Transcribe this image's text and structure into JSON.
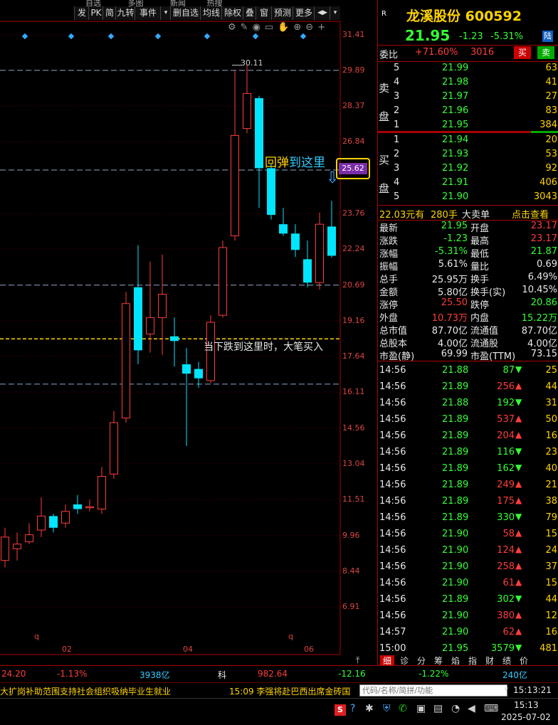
{
  "toolbar": {
    "buttons": [
      "发",
      "PK",
      "简",
      "九转",
      "事件",
      "▾",
      "删自选",
      "均线",
      "除权",
      "叠",
      "窗",
      "预测",
      "更多",
      "◀▶",
      "▾"
    ],
    "top_menu": [
      "自选",
      "多图",
      "新闻",
      "热搜"
    ]
  },
  "chart": {
    "price_labels": [
      "31.41",
      "29.89",
      "28.37",
      "26.84",
      "25.62",
      "23.76",
      "22.24",
      "20.69",
      "19.16",
      "17.64",
      "16.11",
      "14.56",
      "13.04",
      "11.51",
      "9.96",
      "8.44",
      "6.91"
    ],
    "date_labels": [
      "02",
      "04",
      "06"
    ],
    "high_marker": "30.11",
    "annotation_rebound_a": "回弹",
    "annotation_rebound_b": "到这里",
    "annotation_buy": "当下跌到这里时，大笔买入",
    "current_price_tag": "25.62",
    "q_marks": [
      "q",
      "q"
    ]
  },
  "chart_data": {
    "type": "candlestick",
    "ylim": [
      6.0,
      32.0
    ],
    "candles": [
      {
        "o": 8.9,
        "c": 9.9,
        "h": 10.3,
        "l": 8.6
      },
      {
        "o": 9.4,
        "c": 9.6,
        "h": 10.1,
        "l": 8.9
      },
      {
        "o": 9.7,
        "c": 10.0,
        "h": 10.5,
        "l": 9.6
      },
      {
        "o": 10.2,
        "c": 10.8,
        "h": 11.6,
        "l": 9.9
      },
      {
        "o": 10.8,
        "c": 10.3,
        "h": 10.9,
        "l": 10.1
      },
      {
        "o": 10.5,
        "c": 11.0,
        "h": 11.3,
        "l": 10.3
      },
      {
        "o": 11.3,
        "c": 11.1,
        "h": 11.7,
        "l": 10.9
      },
      {
        "o": 11.2,
        "c": 11.2,
        "h": 11.5,
        "l": 11.0
      },
      {
        "o": 11.1,
        "c": 12.5,
        "h": 12.9,
        "l": 10.9
      },
      {
        "o": 12.6,
        "c": 14.8,
        "h": 15.3,
        "l": 12.4
      },
      {
        "o": 15.0,
        "c": 19.9,
        "h": 20.4,
        "l": 14.8
      },
      {
        "o": 20.6,
        "c": 17.9,
        "h": 22.4,
        "l": 17.3
      },
      {
        "o": 18.6,
        "c": 19.3,
        "h": 21.7,
        "l": 17.8
      },
      {
        "o": 19.3,
        "c": 20.3,
        "h": 22.0,
        "l": 17.7
      },
      {
        "o": 18.5,
        "c": 18.3,
        "h": 19.3,
        "l": 17.2
      },
      {
        "o": 17.3,
        "c": 16.9,
        "h": 18.0,
        "l": 13.8
      },
      {
        "o": 17.1,
        "c": 16.7,
        "h": 17.4,
        "l": 16.3
      },
      {
        "o": 16.6,
        "c": 19.1,
        "h": 19.4,
        "l": 16.5
      },
      {
        "o": 19.4,
        "c": 22.3,
        "h": 22.6,
        "l": 19.3
      },
      {
        "o": 22.8,
        "c": 27.1,
        "h": 29.9,
        "l": 22.6
      },
      {
        "o": 27.4,
        "c": 28.9,
        "h": 30.11,
        "l": 27.2
      },
      {
        "o": 28.7,
        "c": 25.7,
        "h": 28.8,
        "l": 24.0
      },
      {
        "o": 25.7,
        "c": 23.7,
        "h": 25.9,
        "l": 23.5
      },
      {
        "o": 23.3,
        "c": 22.9,
        "h": 24.0,
        "l": 22.8
      },
      {
        "o": 22.9,
        "c": 22.2,
        "h": 23.3,
        "l": 21.9
      },
      {
        "o": 21.8,
        "c": 20.8,
        "h": 22.6,
        "l": 20.6
      },
      {
        "o": 20.8,
        "c": 23.3,
        "h": 23.8,
        "l": 20.5
      },
      {
        "o": 23.2,
        "c": 21.95,
        "h": 24.3,
        "l": 21.87
      }
    ],
    "h_lines": [
      29.89,
      25.62,
      20.69,
      18.39,
      16.45
    ]
  },
  "header": {
    "r_badge": "R",
    "name": "龙溪股份",
    "code": "600592",
    "price": "21.95",
    "change": "-1.23",
    "pct": "-5.31%",
    "tag": "陆"
  },
  "weibi": {
    "label": "委比",
    "ratio": "+71.60%",
    "diff": "3016",
    "buy": "买",
    "sell": "卖"
  },
  "sell_side": {
    "label": "卖盘",
    "rows": [
      {
        "lvl": "5",
        "price": "21.99",
        "vol": "63"
      },
      {
        "lvl": "4",
        "price": "21.98",
        "vol": "41"
      },
      {
        "lvl": "3",
        "price": "21.97",
        "vol": "27"
      },
      {
        "lvl": "2",
        "price": "21.96",
        "vol": "83"
      },
      {
        "lvl": "1",
        "price": "21.95",
        "vol": "384"
      }
    ]
  },
  "buy_side": {
    "label": "买盘",
    "rows": [
      {
        "lvl": "1",
        "price": "21.94",
        "vol": "20"
      },
      {
        "lvl": "2",
        "price": "21.93",
        "vol": "53"
      },
      {
        "lvl": "3",
        "price": "21.92",
        "vol": "92"
      },
      {
        "lvl": "4",
        "price": "21.91",
        "vol": "406"
      },
      {
        "lvl": "5",
        "price": "21.90",
        "vol": "3043"
      }
    ]
  },
  "bigorder": {
    "a": "22.03元有",
    "b": "280手",
    "c": "大卖单",
    "d": "点击查看"
  },
  "stats": [
    {
      "l1": "最新",
      "v1": "21.95",
      "c1": "green",
      "l2": "开盘",
      "v2": "23.17",
      "c2": "red"
    },
    {
      "l1": "涨跌",
      "v1": "-1.23",
      "c1": "green",
      "l2": "最高",
      "v2": "23.17",
      "c2": "red"
    },
    {
      "l1": "涨幅",
      "v1": "-5.31%",
      "c1": "green",
      "l2": "最低",
      "v2": "21.87",
      "c2": "green"
    },
    {
      "l1": "振幅",
      "v1": "5.61%",
      "c1": "white",
      "l2": "量比",
      "v2": "0.69",
      "c2": "white"
    },
    {
      "l1": "总手",
      "v1": "25.95万",
      "c1": "white",
      "l2": "换手",
      "v2": "6.49%",
      "c2": "white"
    },
    {
      "l1": "金额",
      "v1": "5.80亿",
      "c1": "white",
      "l2": "换手(实)",
      "v2": "10.45%",
      "c2": "white"
    },
    {
      "l1": "涨停",
      "v1": "25.50",
      "c1": "red",
      "l2": "跌停",
      "v2": "20.86",
      "c2": "green"
    },
    {
      "l1": "外盘",
      "v1": "10.73万",
      "c1": "red",
      "l2": "内盘",
      "v2": "15.22万",
      "c2": "green"
    },
    {
      "l1": "总市值",
      "v1": "87.70亿",
      "c1": "white",
      "l2": "流通值",
      "v2": "87.70亿",
      "c2": "white"
    },
    {
      "l1": "总股本",
      "v1": "4.00亿",
      "c1": "white",
      "l2": "流通股",
      "v2": "4.00亿",
      "c2": "white"
    },
    {
      "l1": "市盈(静)",
      "v1": "69.99",
      "c1": "white",
      "l2": "市盈(TTM)",
      "v2": "73.15",
      "c2": "white"
    }
  ],
  "ticks": [
    {
      "t": "14:56",
      "p": "21.88",
      "v": "87",
      "d": "down",
      "x": "25"
    },
    {
      "t": "14:56",
      "p": "21.89",
      "v": "256",
      "d": "up",
      "x": "44"
    },
    {
      "t": "14:56",
      "p": "21.88",
      "v": "192",
      "d": "down",
      "x": "31"
    },
    {
      "t": "14:56",
      "p": "21.89",
      "v": "537",
      "d": "up",
      "x": "50"
    },
    {
      "t": "14:56",
      "p": "21.89",
      "v": "204",
      "d": "up",
      "x": "16"
    },
    {
      "t": "14:56",
      "p": "21.89",
      "v": "116",
      "d": "down",
      "x": "23"
    },
    {
      "t": "14:56",
      "p": "21.89",
      "v": "162",
      "d": "down",
      "x": "40"
    },
    {
      "t": "14:56",
      "p": "21.89",
      "v": "249",
      "d": "up",
      "x": "21"
    },
    {
      "t": "14:56",
      "p": "21.89",
      "v": "175",
      "d": "up",
      "x": "38"
    },
    {
      "t": "14:56",
      "p": "21.89",
      "v": "330",
      "d": "down",
      "x": "79"
    },
    {
      "t": "14:56",
      "p": "21.90",
      "v": "58",
      "d": "up",
      "x": "15"
    },
    {
      "t": "14:56",
      "p": "21.90",
      "v": "124",
      "d": "up",
      "x": "24"
    },
    {
      "t": "14:56",
      "p": "21.90",
      "v": "258",
      "d": "up",
      "x": "37"
    },
    {
      "t": "14:56",
      "p": "21.90",
      "v": "61",
      "d": "up",
      "x": "15"
    },
    {
      "t": "14:56",
      "p": "21.89",
      "v": "302",
      "d": "down",
      "x": "44"
    },
    {
      "t": "14:56",
      "p": "21.90",
      "v": "380",
      "d": "up",
      "x": "12"
    },
    {
      "t": "14:57",
      "p": "21.90",
      "v": "62",
      "d": "up",
      "x": "16"
    },
    {
      "t": "15:00",
      "p": "21.95",
      "v": "3579",
      "d": "down",
      "x": "481"
    }
  ],
  "panel_tabs": [
    "细",
    "诊",
    "分",
    "筹",
    "焰",
    "指",
    "财",
    "绩",
    "价"
  ],
  "status_bar": {
    "a": "24.20",
    "b": "-1.13%",
    "c": "3938亿",
    "d": "科",
    "e": "982.64",
    "f": "-12.16",
    "g": "-1.22%",
    "h": "240亿"
  },
  "news": {
    "a": "大扩岗补助范围支持社会组织吸纳毕业生就业",
    "b": "15:09 李强将赴巴西出席金砖国",
    "search_placeholder": "代码/名称/简拼/功能",
    "clock": "15:13:21"
  },
  "taskbar": {
    "time": "15:13",
    "date": "2025-07-02"
  },
  "colors": {
    "up": "#ff3c3c",
    "down": "#00e5ff",
    "grid": "#8aa",
    "accent_yellow": "#ffd400"
  }
}
